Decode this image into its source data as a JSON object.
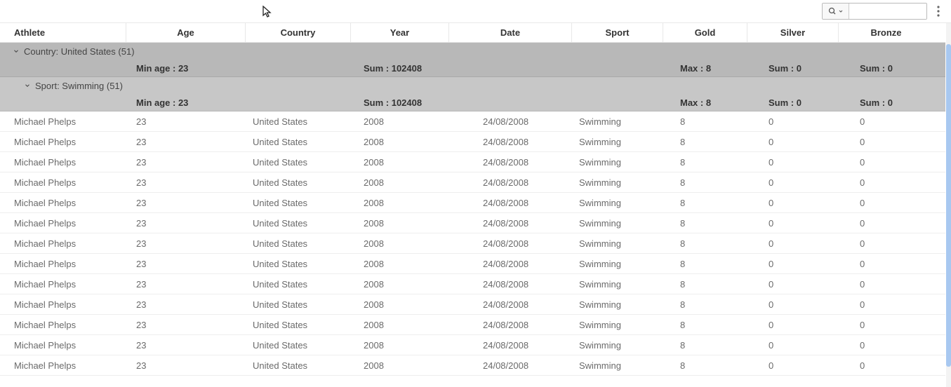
{
  "toolbar": {
    "search_value": "",
    "search_placeholder": ""
  },
  "columns": {
    "athlete": "Athlete",
    "age": "Age",
    "country": "Country",
    "year": "Year",
    "date": "Date",
    "sport": "Sport",
    "gold": "Gold",
    "silver": "Silver",
    "bronze": "Bronze"
  },
  "group1": {
    "label": "Country: United States (51)",
    "agg_age": "Min age : 23",
    "agg_year": "Sum : 102408",
    "agg_gold": "Max : 8",
    "agg_silver": "Sum : 0",
    "agg_bronze": "Sum : 0"
  },
  "group2": {
    "label": "Sport: Swimming (51)",
    "agg_age": "Min age : 23",
    "agg_year": "Sum : 102408",
    "agg_gold": "Max : 8",
    "agg_silver": "Sum : 0",
    "agg_bronze": "Sum : 0"
  },
  "rows": [
    {
      "athlete": "Michael Phelps",
      "age": "23",
      "country": "United States",
      "year": "2008",
      "date": "24/08/2008",
      "sport": "Swimming",
      "gold": "8",
      "silver": "0",
      "bronze": "0"
    },
    {
      "athlete": "Michael Phelps",
      "age": "23",
      "country": "United States",
      "year": "2008",
      "date": "24/08/2008",
      "sport": "Swimming",
      "gold": "8",
      "silver": "0",
      "bronze": "0"
    },
    {
      "athlete": "Michael Phelps",
      "age": "23",
      "country": "United States",
      "year": "2008",
      "date": "24/08/2008",
      "sport": "Swimming",
      "gold": "8",
      "silver": "0",
      "bronze": "0"
    },
    {
      "athlete": "Michael Phelps",
      "age": "23",
      "country": "United States",
      "year": "2008",
      "date": "24/08/2008",
      "sport": "Swimming",
      "gold": "8",
      "silver": "0",
      "bronze": "0"
    },
    {
      "athlete": "Michael Phelps",
      "age": "23",
      "country": "United States",
      "year": "2008",
      "date": "24/08/2008",
      "sport": "Swimming",
      "gold": "8",
      "silver": "0",
      "bronze": "0"
    },
    {
      "athlete": "Michael Phelps",
      "age": "23",
      "country": "United States",
      "year": "2008",
      "date": "24/08/2008",
      "sport": "Swimming",
      "gold": "8",
      "silver": "0",
      "bronze": "0"
    },
    {
      "athlete": "Michael Phelps",
      "age": "23",
      "country": "United States",
      "year": "2008",
      "date": "24/08/2008",
      "sport": "Swimming",
      "gold": "8",
      "silver": "0",
      "bronze": "0"
    },
    {
      "athlete": "Michael Phelps",
      "age": "23",
      "country": "United States",
      "year": "2008",
      "date": "24/08/2008",
      "sport": "Swimming",
      "gold": "8",
      "silver": "0",
      "bronze": "0"
    },
    {
      "athlete": "Michael Phelps",
      "age": "23",
      "country": "United States",
      "year": "2008",
      "date": "24/08/2008",
      "sport": "Swimming",
      "gold": "8",
      "silver": "0",
      "bronze": "0"
    },
    {
      "athlete": "Michael Phelps",
      "age": "23",
      "country": "United States",
      "year": "2008",
      "date": "24/08/2008",
      "sport": "Swimming",
      "gold": "8",
      "silver": "0",
      "bronze": "0"
    },
    {
      "athlete": "Michael Phelps",
      "age": "23",
      "country": "United States",
      "year": "2008",
      "date": "24/08/2008",
      "sport": "Swimming",
      "gold": "8",
      "silver": "0",
      "bronze": "0"
    },
    {
      "athlete": "Michael Phelps",
      "age": "23",
      "country": "United States",
      "year": "2008",
      "date": "24/08/2008",
      "sport": "Swimming",
      "gold": "8",
      "silver": "0",
      "bronze": "0"
    },
    {
      "athlete": "Michael Phelps",
      "age": "23",
      "country": "United States",
      "year": "2008",
      "date": "24/08/2008",
      "sport": "Swimming",
      "gold": "8",
      "silver": "0",
      "bronze": "0"
    }
  ]
}
